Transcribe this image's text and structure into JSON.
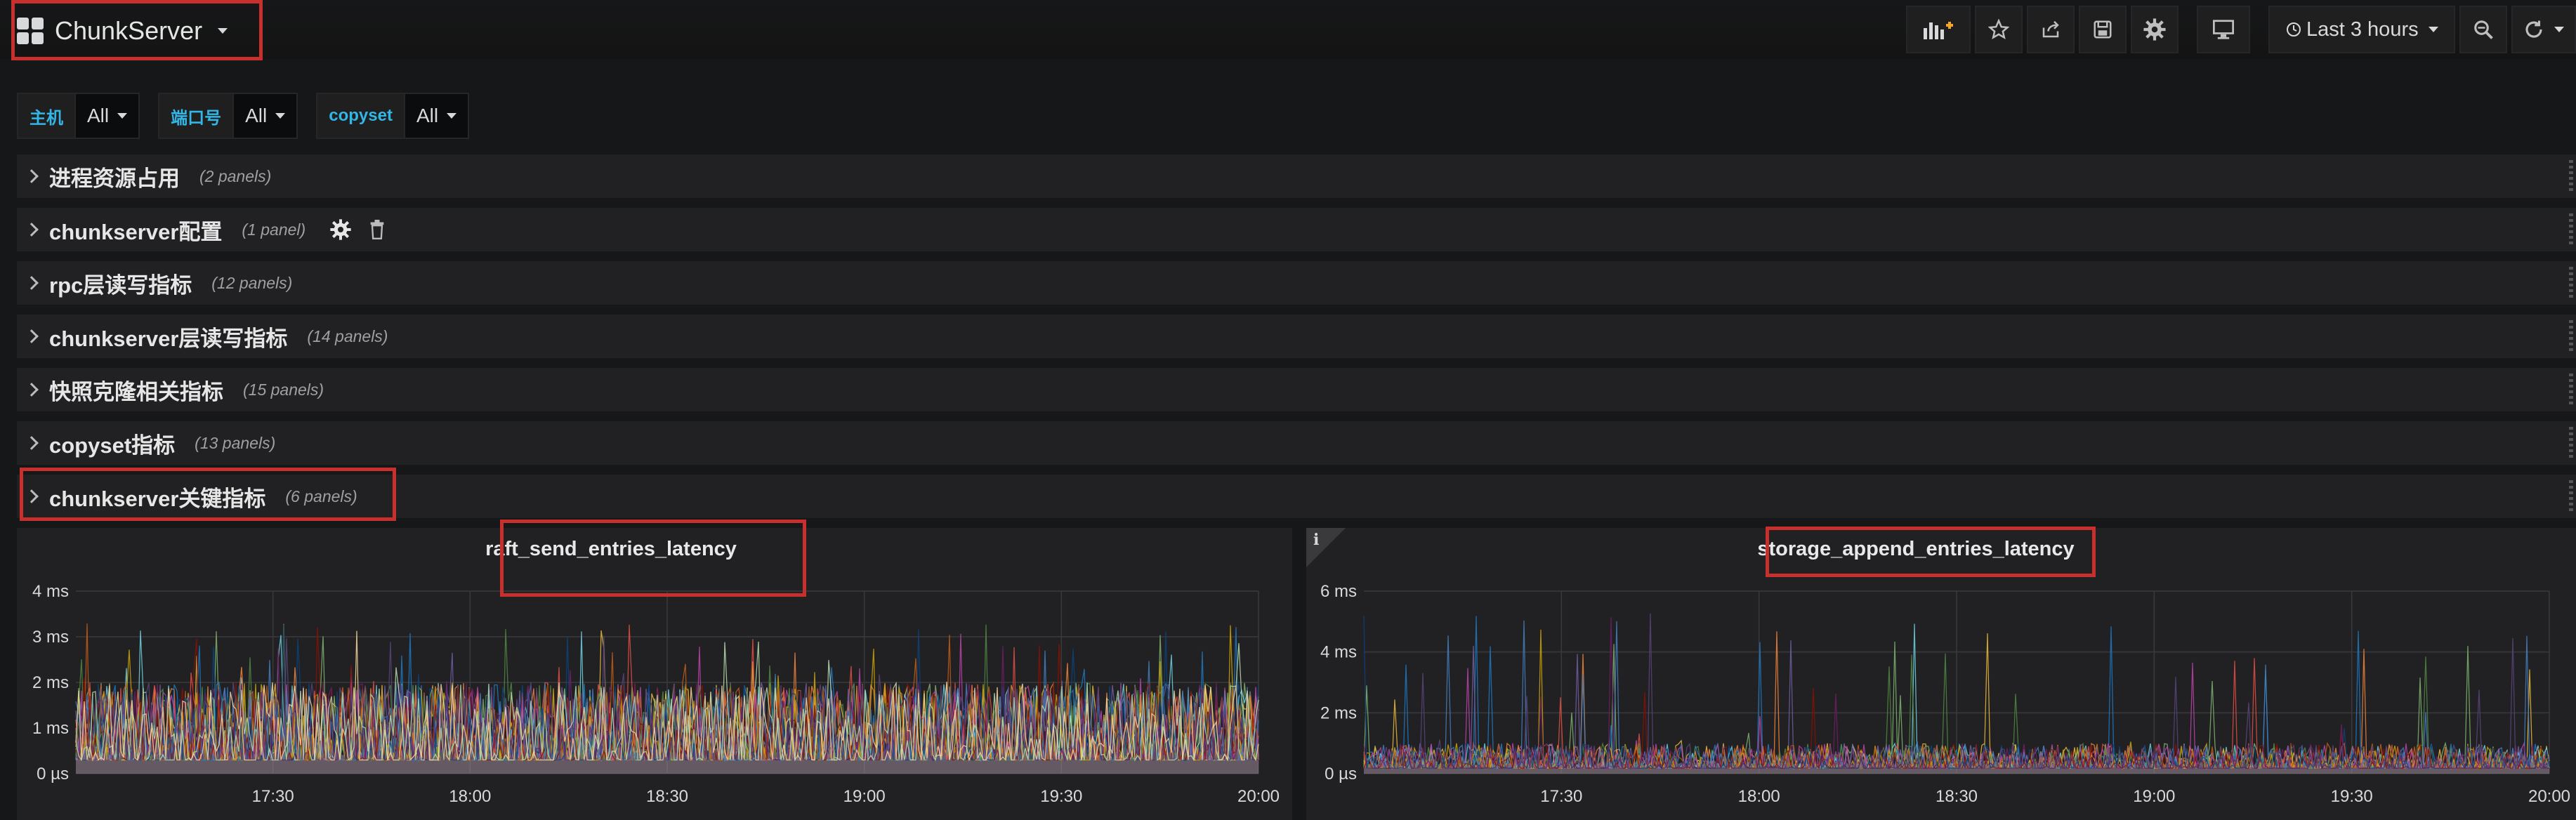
{
  "header": {
    "dashboard_title": "ChunkServer",
    "time_range": "Last 3 hours"
  },
  "icons": {
    "add_panel": "add-panel-icon",
    "star": "star-icon",
    "share": "share-icon",
    "save": "save-icon",
    "settings": "gear-icon",
    "tv_mode": "monitor-icon",
    "clock": "clock-icon",
    "zoom_out": "zoom-out-icon",
    "refresh": "refresh-icon"
  },
  "variables": [
    {
      "label": "主机",
      "value": "All"
    },
    {
      "label": "端口号",
      "value": "All"
    },
    {
      "label": "copyset",
      "value": "All"
    }
  ],
  "rows": [
    {
      "title": "进程资源占用",
      "count": "(2 panels)"
    },
    {
      "title": "chunkserver配置",
      "count": "(1 panel)"
    },
    {
      "title": "rpc层读写指标",
      "count": "(12 panels)"
    },
    {
      "title": "chunkserver层读写指标",
      "count": "(14 panels)"
    },
    {
      "title": "快照克隆相关指标",
      "count": "(15 panels)"
    },
    {
      "title": "copyset指标",
      "count": "(13 panels)"
    },
    {
      "title": "chunkserver关键指标",
      "count": "(6 panels)"
    }
  ],
  "panels": [
    {
      "title": "raft_send_entries_latency"
    },
    {
      "title": "storage_append_entries_latency",
      "info_marker": "i"
    }
  ],
  "colors": {
    "background": "#161719",
    "row_bg": "#212124",
    "highlight_box": "#c8302e",
    "var_label": "#33b5e5"
  },
  "chart_data": [
    {
      "type": "line",
      "title": "raft_send_entries_latency",
      "x_ticks": [
        "17:30",
        "18:00",
        "18:30",
        "19:00",
        "19:30",
        "20:00"
      ],
      "y_ticks": [
        "0 µs",
        "1 ms",
        "2 ms",
        "3 ms",
        "4 ms"
      ],
      "ylim_ms": [
        0,
        4
      ],
      "series_count": "many (stacked thin lines)",
      "typical_band_ms": [
        0,
        2
      ],
      "baseline_ms": 0.5,
      "peak_ms": 3.3,
      "grid": true
    },
    {
      "type": "line",
      "title": "storage_append_entries_latency",
      "x_ticks": [
        "17:30",
        "18:00",
        "18:30",
        "19:00",
        "19:30",
        "20:00"
      ],
      "y_ticks": [
        "0 µs",
        "2 ms",
        "4 ms",
        "6 ms"
      ],
      "ylim_ms": [
        0,
        6
      ],
      "series_count": "many (stacked thin lines)",
      "typical_band_ms": [
        0,
        1
      ],
      "baseline_ms": 0.3,
      "peak_ms": 5.3,
      "grid": true
    }
  ]
}
